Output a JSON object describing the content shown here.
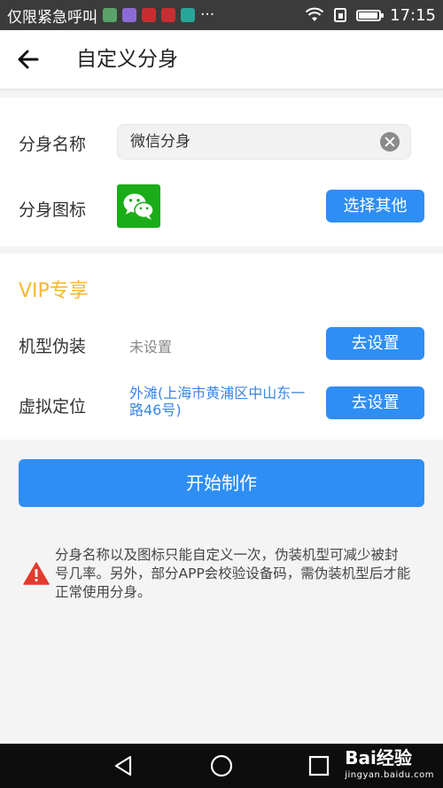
{
  "status_bar": {
    "left_text": "仅限紧急呼叫",
    "more": "···",
    "time": "17:15",
    "battery_level": 0.9,
    "app_icon_colors": [
      "#5aa26a",
      "#8d6bd6",
      "#c62f2f",
      "#c62f2f",
      "#2aa59a"
    ]
  },
  "header": {
    "back_icon": "arrow-left-icon",
    "title": "自定义分身"
  },
  "form": {
    "name_label": "分身名称",
    "name_value": "微信分身",
    "icon_label": "分身图标",
    "icon_name": "wechat-icon",
    "choose_other": "选择其他"
  },
  "vip": {
    "heading": "VIP专享",
    "heading_color": "#f7b733",
    "model_label": "机型伪装",
    "model_value": "未设置",
    "set_button": "去设置",
    "location_label": "虚拟定位",
    "location_value": "外滩(上海市黄浦区中山东一路46号)"
  },
  "start_button": "开始制作",
  "warning": {
    "icon": "warning-triangle-icon",
    "text": "分身名称以及图标只能自定义一次，伪装机型可减少被封号几率。另外，部分APP会校验设备码，需伪装机型后才能正常使用分身。"
  },
  "nav": {
    "back": "nav-back-icon",
    "home": "nav-home-icon",
    "recent": "nav-recent-icon"
  },
  "watermark": {
    "brand": "Bai经验",
    "url": "jingyan.baidu.com"
  },
  "colors": {
    "accent": "#2f8ef4",
    "wechat_green": "#1aad19",
    "warning_red": "#e23b2e"
  }
}
